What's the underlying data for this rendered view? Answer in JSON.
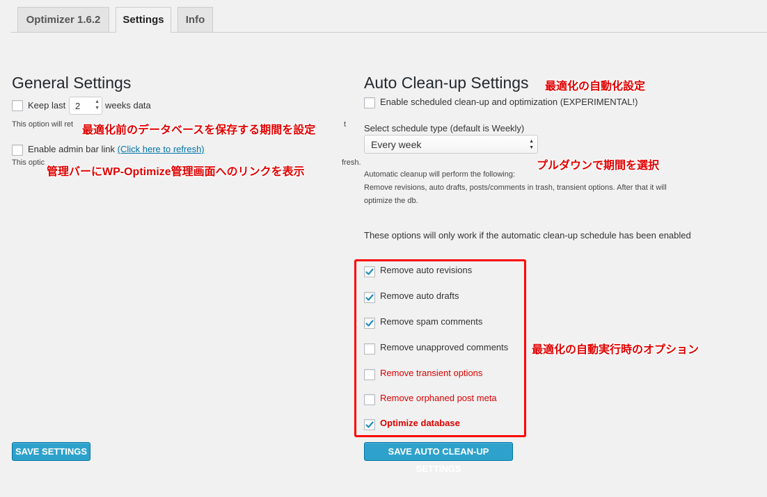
{
  "tabs": [
    {
      "label": "Optimizer 1.6.2"
    },
    {
      "label": "Settings"
    },
    {
      "label": "Info"
    }
  ],
  "general": {
    "title": "General Settings",
    "keep_last_prefix": "Keep last",
    "keep_last_value": "2",
    "keep_last_suffix": "weeks data",
    "keep_note": "This option will ret",
    "keep_note_tail": "t",
    "admin_bar_label": "Enable admin bar link",
    "admin_bar_refresh": "(Click here to refresh)",
    "admin_note": "This optic",
    "admin_note_tail": "fresh.",
    "save_label": "SAVE SETTINGS"
  },
  "auto": {
    "title": "Auto Clean-up Settings",
    "enable_label": "Enable scheduled clean-up and optimization (EXPERIMENTAL!)",
    "schedule_label": "Select schedule type (default is Weekly)",
    "schedule_selected": "Every week",
    "desc_line1": "Automatic cleanup will perform the following:",
    "desc_line2": "Remove revisions, auto drafts, posts/comments in trash, transient options. After that it will",
    "desc_line3": "optimize the db.",
    "notice": "These options will only work if the automatic clean-up schedule has been enabled",
    "options": [
      {
        "label": "Remove auto revisions",
        "checked": true,
        "style": "normal"
      },
      {
        "label": "Remove auto drafts",
        "checked": true,
        "style": "normal"
      },
      {
        "label": "Remove spam comments",
        "checked": true,
        "style": "normal"
      },
      {
        "label": "Remove unapproved comments",
        "checked": false,
        "style": "normal"
      },
      {
        "label": "Remove transient options",
        "checked": false,
        "style": "red"
      },
      {
        "label": "Remove orphaned post meta",
        "checked": false,
        "style": "red"
      },
      {
        "label": "Optimize database",
        "checked": true,
        "style": "red-bold"
      }
    ],
    "save_label": "SAVE AUTO CLEAN-UP SETTINGS"
  },
  "annotations": {
    "auto_title": "最適化の自動化設定",
    "keep_period": "最適化前のデータベースを保存する期間を設定",
    "admin_bar": "管理バーにWP-Optimize管理画面へのリンクを表示",
    "dropdown": "プルダウンで期間を選択",
    "options": "最適化の自動実行時のオプション"
  },
  "colors": {
    "accent": "#2ea2cc",
    "check": "#1e8cbe",
    "annotation": "#e00000"
  }
}
